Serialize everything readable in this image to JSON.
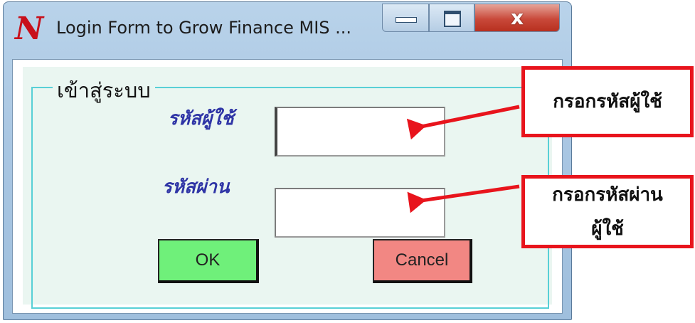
{
  "window": {
    "title": "Login Form to Grow Finance MIS ...",
    "logo": "N",
    "controls": {
      "minimize": "minimize-icon",
      "maximize": "maximize-icon",
      "close": "x"
    }
  },
  "form": {
    "group_caption": "เข้าสู่ระบบ",
    "username_label": "รหัสผู้ใช้",
    "password_label": "รหัสผ่าน",
    "username_value": "",
    "password_value": "",
    "ok_label": "OK",
    "cancel_label": "Cancel"
  },
  "annotations": {
    "username_note": "กรอกรหัสผู้ใช้",
    "password_note_line1": "กรอกรหัสผ่าน",
    "password_note_line2": "ผู้ใช้"
  },
  "colors": {
    "ok_button": "#6ff07a",
    "cancel_button": "#f28783",
    "label_text": "#2f35a6",
    "callout_border": "#e8141c",
    "group_border": "#58d0d6"
  }
}
